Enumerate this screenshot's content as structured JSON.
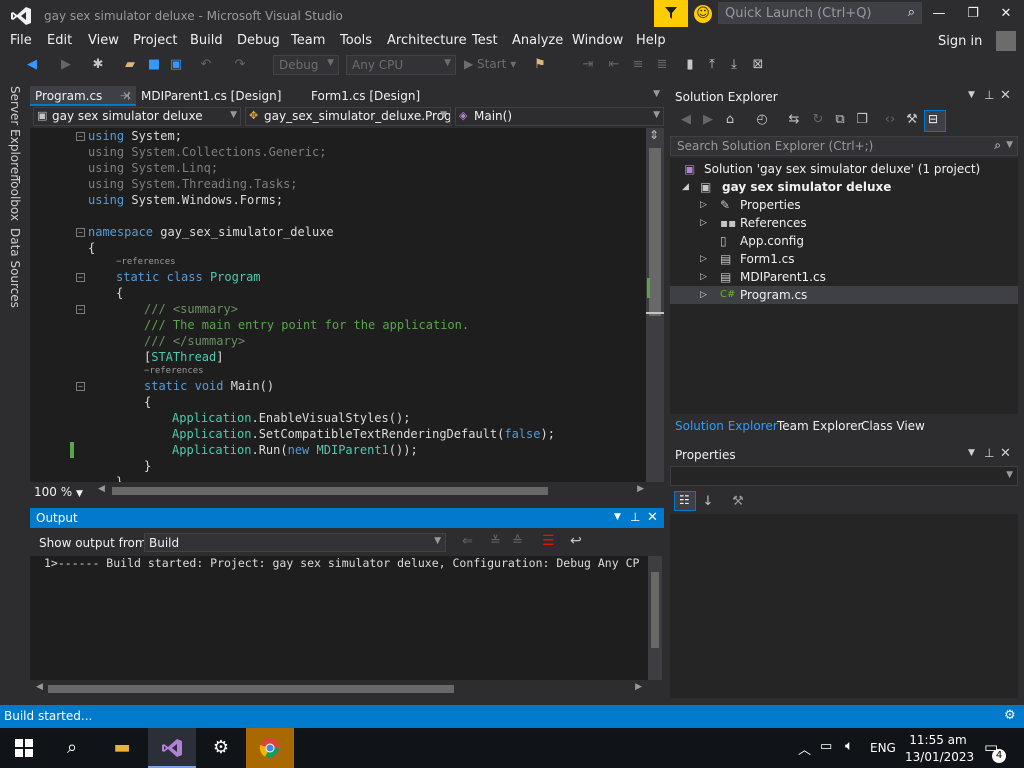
{
  "window": {
    "title": "gay sex simulator deluxe - Microsoft Visual Studio",
    "quick_launch_placeholder": "Quick Launch (Ctrl+Q)",
    "sign_in": "Sign in"
  },
  "menu": [
    "File",
    "Edit",
    "View",
    "Project",
    "Build",
    "Debug",
    "Team",
    "Tools",
    "Architecture",
    "Test",
    "Analyze",
    "Window",
    "Help"
  ],
  "toolbar": {
    "config": "Debug",
    "platform": "Any CPU",
    "start": "Start"
  },
  "side_tabs": [
    "Server Explorer",
    "Toolbox",
    "Data Sources"
  ],
  "doc_tabs": [
    {
      "label": "Program.cs",
      "active": true
    },
    {
      "label": "MDIParent1.cs [Design]",
      "active": false
    },
    {
      "label": "Form1.cs [Design]",
      "active": false
    }
  ],
  "nav": {
    "project": "gay sex simulator deluxe",
    "class": "gay_sex_simulator_deluxe.Progra",
    "member": "Main()"
  },
  "code": {
    "using1": "System;",
    "using2": "System.Collections.Generic;",
    "using3": "System.Linq;",
    "using4": "System.Threading.Tasks;",
    "using5": "System.Windows.Forms;",
    "kw_using": "using",
    "kw_namespace": "namespace",
    "namespace_name": "gay_sex_simulator_deluxe",
    "open_brace": "{",
    "close_brace": "}",
    "references": "−references",
    "kw_static": "static",
    "kw_class": "class",
    "class_name": "Program",
    "doc1": "/// <summary>",
    "doc2": "/// The main entry point for the application.",
    "doc3": "/// </summary>",
    "attr_open": "[",
    "attr_name": "STAThread",
    "attr_close": "]",
    "kw_void": "void",
    "method": "Main()",
    "app": "Application",
    "call1": ".EnableVisualStyles();",
    "call2": ".SetCompatibleTextRenderingDefault(",
    "kw_false": "false",
    "call2_end": ");",
    "call3": ".Run(",
    "kw_new": "new",
    "mdi": "MDIParent1",
    "call3_end": "());"
  },
  "zoom": "100 %",
  "output": {
    "title": "Output",
    "show_from_label": "Show output from:",
    "source": "Build",
    "line": "1>------ Build started: Project: gay sex simulator deluxe, Configuration: Debug Any CP"
  },
  "solution_explorer": {
    "title": "Solution Explorer",
    "search_placeholder": "Search Solution Explorer (Ctrl+;)",
    "solution": "Solution 'gay sex simulator deluxe' (1 project)",
    "project": "gay sex simulator deluxe",
    "items": [
      "Properties",
      "References",
      "App.config",
      "Form1.cs",
      "MDIParent1.cs",
      "Program.cs"
    ],
    "bottom_tabs": [
      "Solution Explorer",
      "Team Explorer",
      "Class View"
    ]
  },
  "properties": {
    "title": "Properties"
  },
  "status": "Build started...",
  "taskbar": {
    "time": "11:55 am",
    "date": "13/01/2023",
    "lang": "ENG",
    "notifications": "4"
  },
  "colors": {
    "accent": "#007acc",
    "background": "#2d2d30",
    "editor": "#1e1e1e"
  }
}
